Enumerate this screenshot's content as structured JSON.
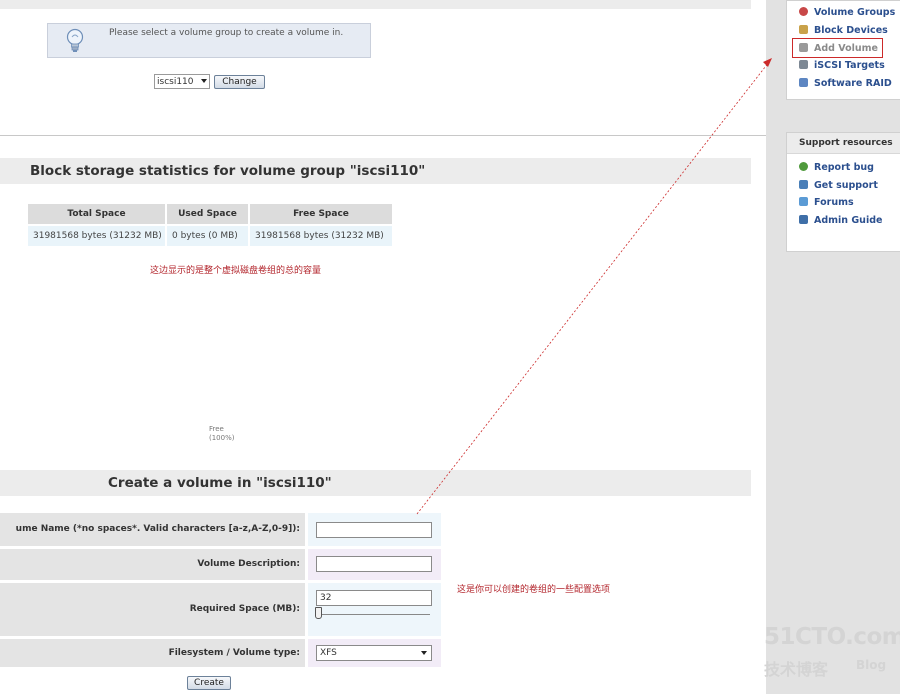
{
  "header": {
    "info_message": "Please select a volume group to create a volume in.",
    "volume_group_select": "iscsi110",
    "change_button": "Change"
  },
  "stats": {
    "title": "Block storage statistics for volume group \"iscsi110\"",
    "columns": [
      "Total Space",
      "Used Space",
      "Free Space"
    ],
    "row": [
      "31981568 bytes (31232 MB)",
      "0 bytes (0 MB)",
      "31981568 bytes (31232 MB)"
    ],
    "note": "这边显示的是整个虚拟磁盘卷组的总的容量",
    "pie_label_1": "Free",
    "pie_label_2": "(100%)"
  },
  "create": {
    "title": "Create a volume in \"iscsi110\"",
    "name_label": "ume Name (*no spaces*. Valid characters [a-z,A-Z,0-9]):",
    "name_value": "",
    "description_label": "Volume Description:",
    "description_value": "",
    "space_label": "Required Space (MB):",
    "space_value": "32",
    "fs_label": "Filesystem / Volume type:",
    "fs_value": "XFS",
    "create_button": "Create",
    "note": "这是你可以创建的卷组的一些配置选项"
  },
  "sidebar": {
    "items": [
      "Volume Groups",
      "Block Devices",
      "Add Volume",
      "iSCSI Targets",
      "Software RAID"
    ],
    "support_title": "Support resources",
    "support_items": [
      "Report bug",
      "Get support",
      "Forums",
      "Admin Guide"
    ],
    "colors": {
      "link": "#2b4f8e",
      "highlight": "#cc2a2a"
    }
  },
  "watermark": {
    "line1": "51CTO.com",
    "line2": "技术博客",
    "line3": "Blog"
  }
}
